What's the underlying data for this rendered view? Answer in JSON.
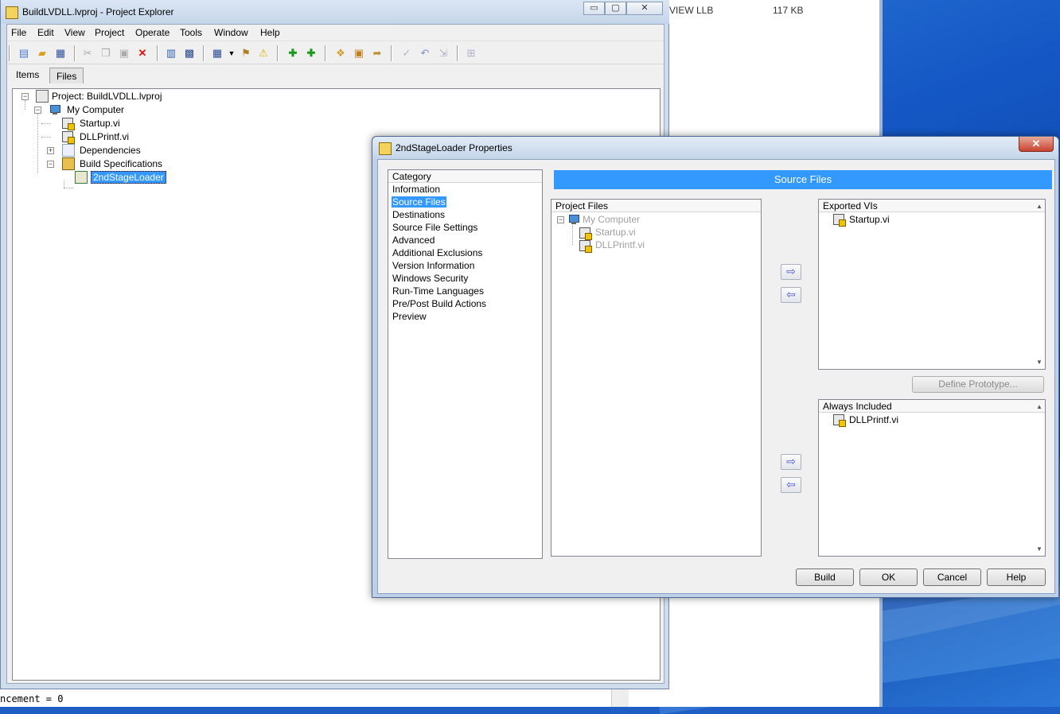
{
  "background_window": {
    "col1": "VIEW LLB",
    "col2": "117 KB"
  },
  "console": {
    "text": "ncement = 0"
  },
  "project_explorer": {
    "title": "BuildLVDLL.lvproj - Project Explorer",
    "caption_buttons": {
      "minimize": "▭",
      "maximize": "▢",
      "close": "✕"
    },
    "menu": [
      "File",
      "Edit",
      "View",
      "Project",
      "Operate",
      "Tools",
      "Window",
      "Help"
    ],
    "tabs": {
      "items": "Items",
      "files": "Files"
    },
    "tree": {
      "project": "Project: BuildLVDLL.lvproj",
      "my_computer": "My Computer",
      "startup": "Startup.vi",
      "dllprintf": "DLLPrintf.vi",
      "dependencies": "Dependencies",
      "build_specs": "Build Specifications",
      "loader": "2ndStageLoader"
    },
    "toolbar_icons": [
      "new-icon",
      "open-icon",
      "save-all-icon",
      "cut-icon",
      "copy-icon",
      "paste-icon",
      "delete-icon",
      "build-icon",
      "save-icon",
      "view-icon",
      "dropdown-icon",
      "filter-icon",
      "warning-icon",
      "add-file-icon",
      "add-folder-icon",
      "files-icon",
      "package-icon",
      "export-icon",
      "checkin-icon",
      "undo-icon",
      "diff-icon",
      "add-icon"
    ]
  },
  "dialog": {
    "title": "2ndStageLoader Properties",
    "close": "✕",
    "category": {
      "header": "Category",
      "items": [
        "Information",
        "Source Files",
        "Destinations",
        "Source File Settings",
        "Advanced",
        "Additional Exclusions",
        "Version Information",
        "Windows Security",
        "Run-Time Languages",
        "Pre/Post Build Actions",
        "Preview"
      ],
      "selected": "Source Files"
    },
    "banner": "Source Files",
    "project_files": {
      "header": "Project Files",
      "items": [
        "My Computer",
        "Startup.vi",
        "DLLPrintf.vi"
      ]
    },
    "exported_vis": {
      "header": "Exported VIs",
      "items": [
        "Startup.vi"
      ]
    },
    "define_prototype": "Define Prototype...",
    "always_included": {
      "header": "Always Included",
      "items": [
        "DLLPrintf.vi"
      ]
    },
    "arrows": {
      "right": "⇨",
      "left": "⇦"
    },
    "buttons": {
      "build": "Build",
      "ok": "OK",
      "cancel": "Cancel",
      "help": "Help"
    }
  }
}
